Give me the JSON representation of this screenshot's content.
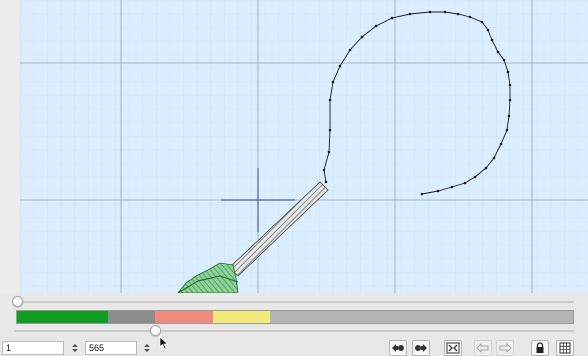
{
  "canvas": {
    "background": "#dbeeff",
    "grid_minor": "#c3dcf2",
    "grid_major": "#8fa3b8",
    "origin_crosshair": "#4a5bb8",
    "stitch_color": "#1a1a1a"
  },
  "timeline": {
    "position_fraction": 0.0
  },
  "color_sequence": [
    {
      "name": "green",
      "color": "#0f9d1f",
      "fraction": 0.163
    },
    {
      "name": "gray",
      "color": "#8c8c8c",
      "fraction": 0.085
    },
    {
      "name": "salmon",
      "color": "#f08a7e",
      "fraction": 0.105
    },
    {
      "name": "yellow",
      "color": "#f1ec78",
      "fraction": 0.102
    },
    {
      "name": "light-gray",
      "color": "#b4b4b4",
      "fraction": 0.545
    }
  ],
  "stitch_range": {
    "start": "1",
    "end": "565",
    "position_fraction": 0.25
  },
  "toolbar": {
    "buttons": [
      {
        "name": "previous-color-button",
        "icon": "previous-color-icon",
        "enabled": true
      },
      {
        "name": "next-color-button",
        "icon": "next-color-icon",
        "enabled": true
      },
      {
        "name": "fit-design-button",
        "icon": "fit-design-icon",
        "enabled": true
      },
      {
        "name": "previous-stitch-button",
        "icon": "previous-stitch-icon",
        "enabled": false
      },
      {
        "name": "next-stitch-button",
        "icon": "next-stitch-icon",
        "enabled": false
      },
      {
        "name": "lock-button",
        "icon": "lock-icon",
        "enabled": true
      },
      {
        "name": "grid-toggle-button",
        "icon": "grid-icon",
        "enabled": true
      }
    ]
  }
}
